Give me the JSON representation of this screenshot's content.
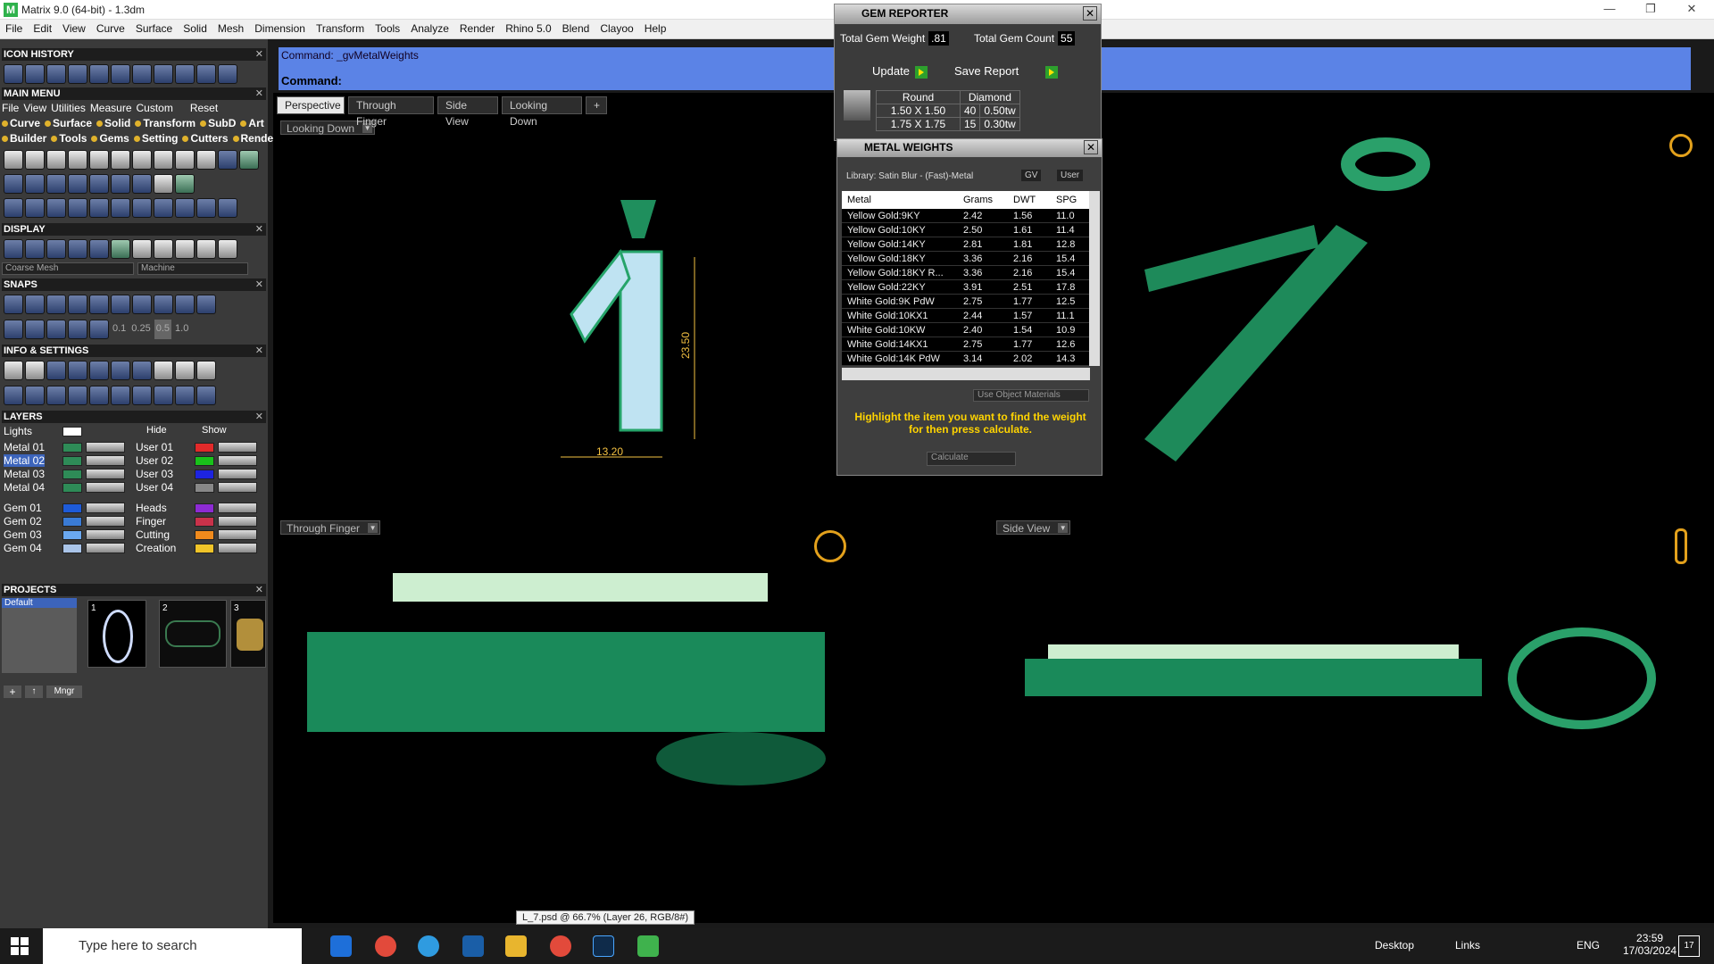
{
  "window": {
    "title": "Matrix 9.0 (64-bit) - 1.3dm"
  },
  "menubar": [
    "File",
    "Edit",
    "View",
    "Curve",
    "Surface",
    "Solid",
    "Mesh",
    "Dimension",
    "Transform",
    "Tools",
    "Analyze",
    "Render",
    "Rhino 5.0",
    "Blend",
    "Clayoo",
    "Help"
  ],
  "left": {
    "icon_history": "ICON HISTORY",
    "main_menu": "MAIN MENU",
    "mm_row1": [
      "File",
      "View",
      "Utilities",
      "Measure",
      "Custom",
      "Reset"
    ],
    "mm_row2": [
      "Curve",
      "Surface",
      "Solid",
      "Transform",
      "SubD",
      "Art"
    ],
    "mm_row3": [
      "Builder",
      "Tools",
      "Gems",
      "Setting",
      "Cutters",
      "Render"
    ],
    "display": "DISPLAY",
    "mesh_sel": "Coarse Mesh",
    "machine_sel": "Machine",
    "snaps": "SNAPS",
    "snap_vals": [
      "0.1",
      "0.25",
      "0.5",
      "1.0"
    ],
    "info": "INFO & SETTINGS",
    "layers": "LAYERS",
    "layer_lights": "Lights",
    "layer_hide": "Hide",
    "layer_show": "Show",
    "layer_left": [
      "Metal 01",
      "Metal 02",
      "Metal 03",
      "Metal 04",
      "Gem 01",
      "Gem 02",
      "Gem 03",
      "Gem 04"
    ],
    "layer_right": [
      "User 01",
      "User 02",
      "User 03",
      "User 04",
      "Heads",
      "Finger",
      "Cutting",
      "Creation"
    ],
    "projects": "PROJECTS",
    "project_default": "Default",
    "project_nums": [
      "1",
      "2",
      "3"
    ],
    "mngr": "Mngr"
  },
  "command": {
    "history": "Command: _gvMetalWeights",
    "prompt": "Command:"
  },
  "tabs": [
    "Perspective",
    "Through Finger",
    "Side View",
    "Looking Down"
  ],
  "viewports": {
    "top_left": "Looking Down",
    "bottom_left": "Through Finger",
    "bottom_right": "Side View",
    "dim_h": "13.20",
    "dim_v": "23.50"
  },
  "gem_reporter": {
    "title": "GEM REPORTER",
    "total_weight_label": "Total Gem Weight",
    "total_weight": ".81",
    "total_count_label": "Total Gem Count",
    "total_count": "55",
    "update": "Update",
    "save": "Save Report",
    "cols": [
      "Round",
      "Diamond"
    ],
    "rows": [
      {
        "size": "1.50 X 1.50",
        "count": "40",
        "wt": "0.50tw"
      },
      {
        "size": "1.75 X 1.75",
        "count": "15",
        "wt": "0.30tw"
      }
    ]
  },
  "metal_weights": {
    "title": "METAL WEIGHTS",
    "library": "Library: Satin Blur - (Fast)-Metal",
    "gv": "GV",
    "user": "User",
    "headers": [
      "Metal",
      "Grams",
      "DWT",
      "SPG"
    ],
    "rows": [
      [
        "Yellow Gold:9KY",
        "2.42",
        "1.56",
        "11.0"
      ],
      [
        "Yellow Gold:10KY",
        "2.50",
        "1.61",
        "11.4"
      ],
      [
        "Yellow Gold:14KY",
        "2.81",
        "1.81",
        "12.8"
      ],
      [
        "Yellow Gold:18KY",
        "3.36",
        "2.16",
        "15.4"
      ],
      [
        "Yellow Gold:18KY R...",
        "3.36",
        "2.16",
        "15.4"
      ],
      [
        "Yellow Gold:22KY",
        "3.91",
        "2.51",
        "17.8"
      ],
      [
        "White Gold:9K PdW",
        "2.75",
        "1.77",
        "12.5"
      ],
      [
        "White Gold:10KX1",
        "2.44",
        "1.57",
        "11.1"
      ],
      [
        "White Gold:10KW",
        "2.40",
        "1.54",
        "10.9"
      ],
      [
        "White Gold:14KX1",
        "2.75",
        "1.77",
        "12.6"
      ],
      [
        "White Gold:14K PdW",
        "3.14",
        "2.02",
        "14.3"
      ]
    ],
    "use_obj": "Use Object Materials",
    "hint": "Highlight the item you want to find the weight for then press calculate.",
    "calc": "Calculate"
  },
  "status_tooltip": "L_7.psd @ 66.7% (Layer 26, RGB/8#)",
  "taskbar": {
    "search": "Type here to search",
    "desktop": "Desktop",
    "links": "Links",
    "lang": "ENG",
    "time": "23:59",
    "date": "17/03/2024",
    "notif": "17"
  }
}
